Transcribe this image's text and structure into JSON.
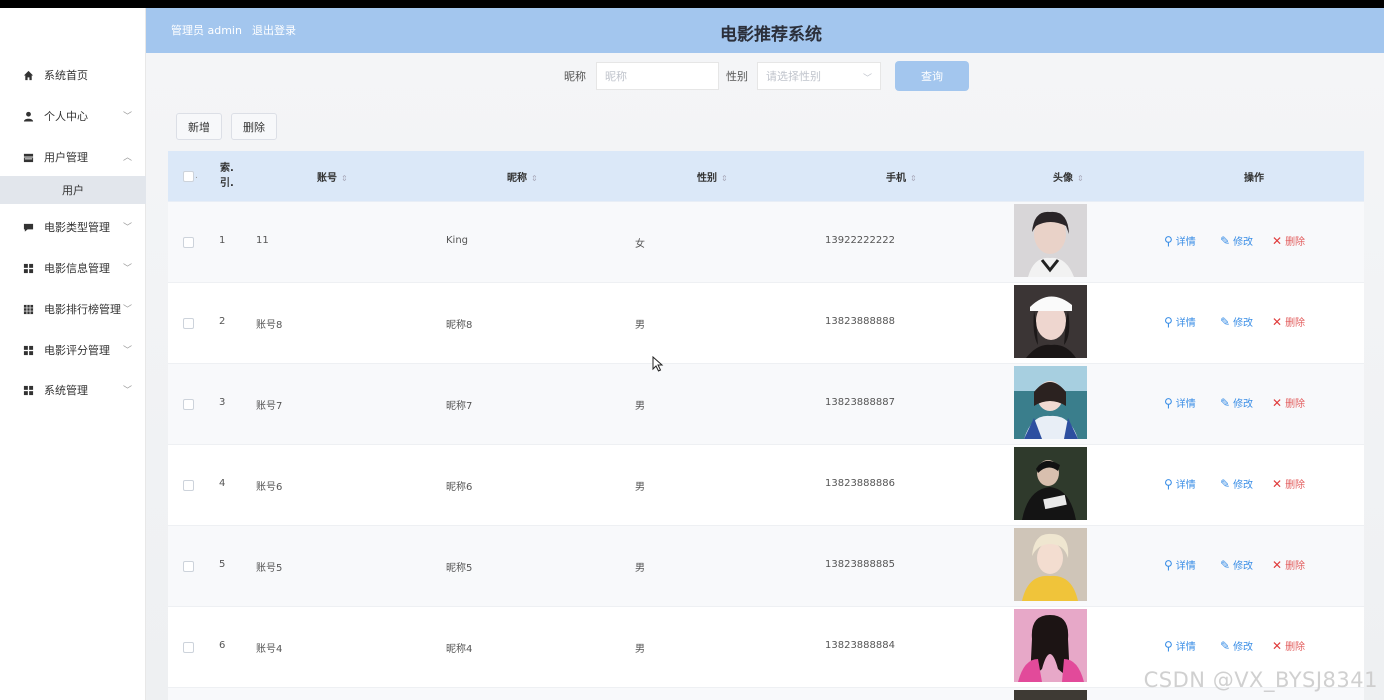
{
  "header": {
    "admin_label": "管理员 admin",
    "logout": "退出登录",
    "title": "电影推荐系统",
    "bg_color": "#a3c6ee"
  },
  "sidebar": {
    "items": [
      {
        "label": "系统首页",
        "icon": "home-icon",
        "expandable": false
      },
      {
        "label": "个人中心",
        "icon": "user-icon",
        "expandable": true
      },
      {
        "label": "用户管理",
        "icon": "user-group-icon",
        "expandable": true,
        "expanded": true
      },
      {
        "label": "电影类型管理",
        "icon": "chat-icon",
        "expandable": true
      },
      {
        "label": "电影信息管理",
        "icon": "grid-icon",
        "expandable": true
      },
      {
        "label": "电影排行榜管理",
        "icon": "table-icon",
        "expandable": true
      },
      {
        "label": "电影评分管理",
        "icon": "grid-icon",
        "expandable": true
      },
      {
        "label": "系统管理",
        "icon": "grid-icon",
        "expandable": true
      }
    ],
    "active_sub": "用户"
  },
  "search": {
    "nickname_label": "昵称",
    "nickname_placeholder": "昵称",
    "gender_label": "性别",
    "gender_placeholder": "请选择性别",
    "query_button": "查询"
  },
  "toolbar": {
    "add": "新增",
    "delete": "删除"
  },
  "table": {
    "headers": {
      "index": "索.引.",
      "index_line1": "索.",
      "index_line2": "引.",
      "account": "账号",
      "nickname": "昵称",
      "gender": "性别",
      "phone": "手机",
      "avatar": "头像",
      "actions": "操作"
    },
    "rows": [
      {
        "index": "1",
        "account": "11",
        "nickname": "King",
        "gender": "女",
        "phone": "13922222222"
      },
      {
        "index": "2",
        "account": "账号8",
        "nickname": "昵称8",
        "gender": "男",
        "phone": "13823888888"
      },
      {
        "index": "3",
        "account": "账号7",
        "nickname": "昵称7",
        "gender": "男",
        "phone": "13823888887"
      },
      {
        "index": "4",
        "account": "账号6",
        "nickname": "昵称6",
        "gender": "男",
        "phone": "13823888886"
      },
      {
        "index": "5",
        "account": "账号5",
        "nickname": "昵称5",
        "gender": "男",
        "phone": "13823888885"
      },
      {
        "index": "6",
        "account": "账号4",
        "nickname": "昵称4",
        "gender": "男",
        "phone": "13823888884"
      }
    ],
    "actions": {
      "detail": "详情",
      "edit": "修改",
      "delete": "删除"
    }
  },
  "watermark": "CSDN @VX_BYSJ8341"
}
